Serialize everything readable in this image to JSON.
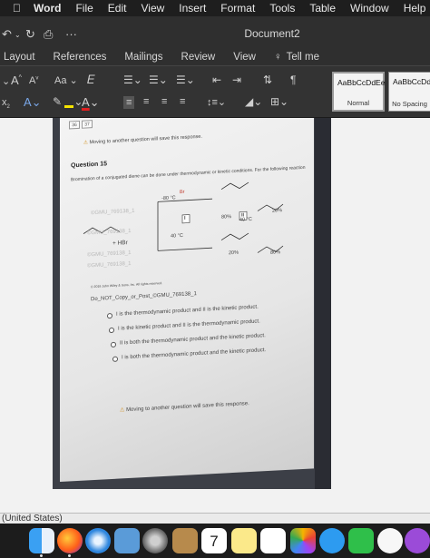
{
  "menubar": {
    "apple": "",
    "items": [
      "Word",
      "File",
      "Edit",
      "View",
      "Insert",
      "Format",
      "Tools",
      "Table",
      "Window",
      "Help"
    ]
  },
  "titlebar": {
    "title": "Document2",
    "more": "···"
  },
  "ribbon_tabs": {
    "items": [
      "Layout",
      "References",
      "Mailings",
      "Review",
      "View"
    ],
    "tell_me": "Tell me"
  },
  "ribbon": {
    "font_size_up": "A",
    "font_size_down": "A",
    "change_case": "Aa",
    "pilcrow": "¶",
    "styles": [
      {
        "preview": "AaBbCcDdEe",
        "name": "Normal"
      },
      {
        "preview": "AaBbCcDdEe",
        "name": "No Spacing"
      }
    ]
  },
  "document": {
    "page_numbers": [
      "36",
      "37"
    ],
    "warning_top": "Moving to another question will save this response.",
    "question_title": "Question 15",
    "question_text": "Bromination of a conjugated diene can be done under thermodynamic or kinetic conditions. For the following reaction",
    "reagent": "+ HBr",
    "conditions": [
      "-80 °C",
      "40 °C",
      "40 °C"
    ],
    "product_labels": [
      "I",
      "II"
    ],
    "yields": [
      "80%",
      "20%",
      "20%",
      "80%"
    ],
    "watermarks": [
      "©GMU_769138_1",
      "©GMU_769138_1",
      "©GMU_769138_1",
      "©GMU_769138_1"
    ],
    "copyright": "© 2019 John Wiley & Sons, Inc. All rights reserved.",
    "do_not_copy": "Do_NOT_Copy_or_Post_©GMU_769138_1",
    "options": [
      "I is the thermodynamic product and II is the kinetic product.",
      "I is the kinetic product and II is the thermodynamic product.",
      "II is both the thermodynamic product and the kinetic product.",
      "I is both the thermodynamic product and the kinetic product."
    ],
    "warning_bottom": "Moving to another question will save this response."
  },
  "statusbar": {
    "language": "(United States)"
  },
  "dock": {
    "icons": [
      "finder-icon",
      "firefox-icon",
      "safari-icon",
      "preview-icon",
      "launchpad-icon",
      "contacts-icon",
      "calendar-icon",
      "notes-icon",
      "reminders-icon",
      "photos-icon",
      "messages-icon",
      "facetime-icon",
      "music-icon",
      "podcasts-icon"
    ],
    "calendar_day": "7"
  }
}
